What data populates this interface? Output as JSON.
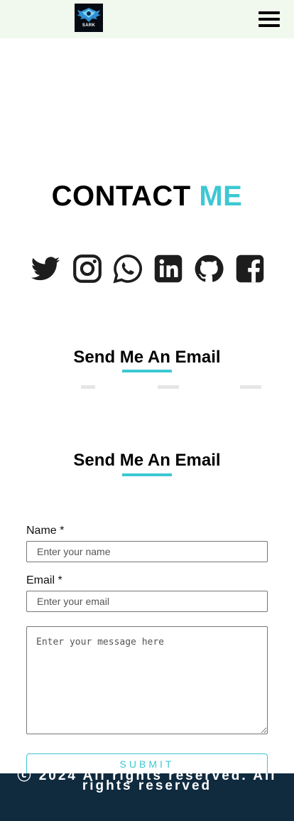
{
  "navbar": {
    "logo_text": "SARK",
    "menu_icon": "hamburger-menu-icon",
    "background": "#f1f9ef"
  },
  "contact": {
    "title_part1": "CONTACT",
    "title_part2": "ME",
    "accent": "#3cc8d2"
  },
  "socials": [
    {
      "name": "twitter",
      "icon": "twitter-icon"
    },
    {
      "name": "instagram",
      "icon": "instagram-icon"
    },
    {
      "name": "whatsapp",
      "icon": "whatsapp-icon"
    },
    {
      "name": "linkedin",
      "icon": "linkedin-icon"
    },
    {
      "name": "github",
      "icon": "github-icon"
    },
    {
      "name": "facebook",
      "icon": "facebook-icon"
    }
  ],
  "email_section": {
    "heading_1": "Send Me An Email",
    "heading_2": "Send Me An Email"
  },
  "form": {
    "name_label": "Name *",
    "name_placeholder": "Enter your name",
    "email_label": "Email *",
    "email_placeholder": "Enter your email",
    "message_placeholder": "Enter your message here",
    "submit_label": "SUBMIT"
  },
  "footer": {
    "line1": "ⓒ 2024 All rights reserved. All",
    "line2": "rights reserved",
    "background": "#102a3e"
  }
}
